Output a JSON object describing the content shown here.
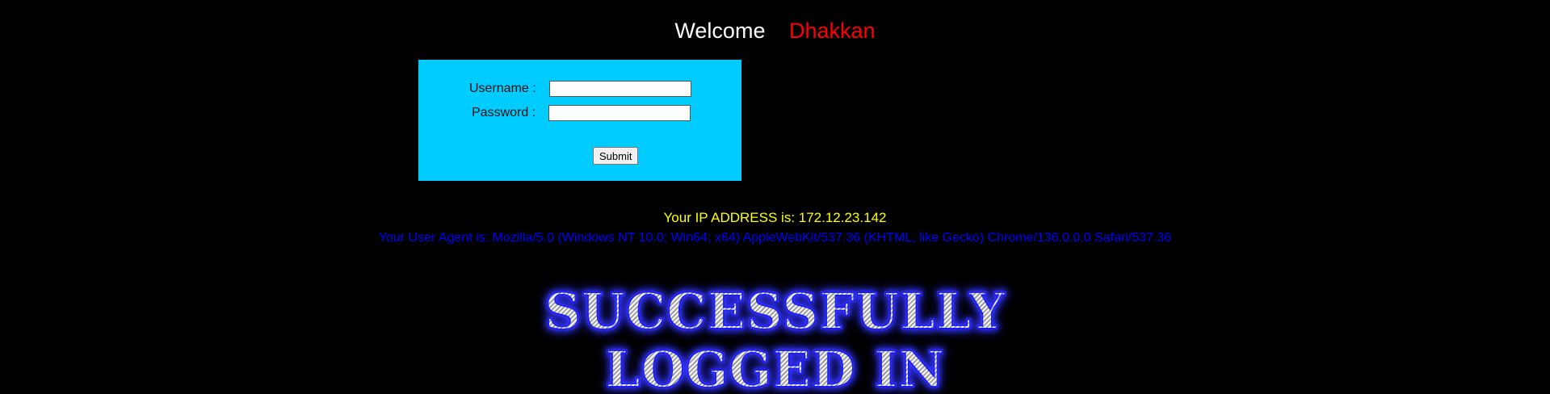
{
  "header": {
    "welcome_text": "Welcome",
    "user_name": "Dhakkan"
  },
  "login_form": {
    "username_label": "Username :",
    "username_value": "",
    "password_label": "Password :",
    "password_value": "",
    "submit_label": "Submit"
  },
  "info": {
    "ip_line": "Your IP ADDRESS is: 172.12.23.142",
    "user_agent_line": "Your User Agent is: Mozilla/5.0 (Windows NT 10.0; Win64; x64) AppleWebKit/537.36 (KHTML, like Gecko) Chrome/136.0.0.0 Safari/537.36"
  },
  "banner": {
    "line1": "SUCCESSFULLY",
    "line2": "LOGGED IN"
  },
  "colors": {
    "background": "#000000",
    "form_background": "#00ccff",
    "welcome": "#ffffff",
    "user_name": "#ff0000",
    "ip_text": "#ffff00",
    "user_agent_text": "#0000ff",
    "banner_outline": "#1a1aff"
  }
}
